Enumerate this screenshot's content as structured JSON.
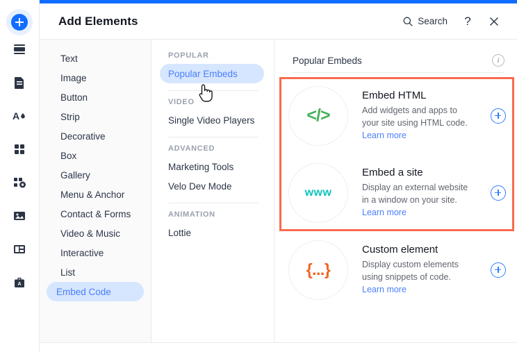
{
  "window": {
    "accent_color": "#116dff",
    "title": "Add Elements"
  },
  "header": {
    "title": "Add Elements",
    "search_label": "Search",
    "help_label": "?",
    "close_label": "✕"
  },
  "rail": {
    "add_label": "+",
    "items": [
      {
        "name": "add-button",
        "label": "Add"
      },
      {
        "name": "sections-icon",
        "label": "Sections"
      },
      {
        "name": "pages-icon",
        "label": "Pages"
      },
      {
        "name": "theme-icon",
        "label": "Site Design"
      },
      {
        "name": "apps-icon",
        "label": "Apps"
      },
      {
        "name": "dev-mode-icon",
        "label": "Dev Mode"
      },
      {
        "name": "media-icon",
        "label": "Media"
      },
      {
        "name": "layouts-icon",
        "label": "Layouts"
      },
      {
        "name": "business-icon",
        "label": "Business"
      }
    ]
  },
  "categories": {
    "items": [
      {
        "label": "Text",
        "selected": false
      },
      {
        "label": "Image",
        "selected": false
      },
      {
        "label": "Button",
        "selected": false
      },
      {
        "label": "Strip",
        "selected": false
      },
      {
        "label": "Decorative",
        "selected": false
      },
      {
        "label": "Box",
        "selected": false
      },
      {
        "label": "Gallery",
        "selected": false
      },
      {
        "label": "Menu & Anchor",
        "selected": false
      },
      {
        "label": "Contact & Forms",
        "selected": false
      },
      {
        "label": "Video & Music",
        "selected": false
      },
      {
        "label": "Interactive",
        "selected": false
      },
      {
        "label": "List",
        "selected": false
      },
      {
        "label": "Embed Code",
        "selected": true
      }
    ]
  },
  "subcategories": {
    "groups": [
      {
        "label": "POPULAR",
        "items": [
          {
            "label": "Popular Embeds",
            "selected": true
          }
        ]
      },
      {
        "label": "VIDEO",
        "items": [
          {
            "label": "Single Video Players",
            "selected": false
          }
        ]
      },
      {
        "label": "ADVANCED",
        "items": [
          {
            "label": "Marketing Tools",
            "selected": false
          },
          {
            "label": "Velo Dev Mode",
            "selected": false
          }
        ]
      },
      {
        "label": "ANIMATION",
        "items": [
          {
            "label": "Lottie",
            "selected": false
          }
        ]
      }
    ]
  },
  "cards_panel": {
    "title": "Popular Embeds",
    "info_label": "i",
    "highlight_color": "#f96a4e",
    "items": [
      {
        "glyph": "</>",
        "glyph_name": "code-brackets-icon",
        "glyph_color": "#45b05c",
        "title": "Embed HTML",
        "desc": "Add widgets and apps to your site using HTML code.",
        "link": "Learn more",
        "add_label": "+"
      },
      {
        "glyph": "www",
        "glyph_name": "www-icon",
        "glyph_color": "#0ec2bc",
        "title": "Embed a site",
        "desc": "Display an external website in a window on your site.",
        "link": "Learn more",
        "add_label": "+"
      },
      {
        "glyph": "{...}",
        "glyph_name": "curly-braces-icon",
        "glyph_color": "#f4631e",
        "title": "Custom element",
        "desc": "Display custom elements using snippets of code.",
        "link": "Learn more",
        "add_label": "+"
      }
    ]
  }
}
